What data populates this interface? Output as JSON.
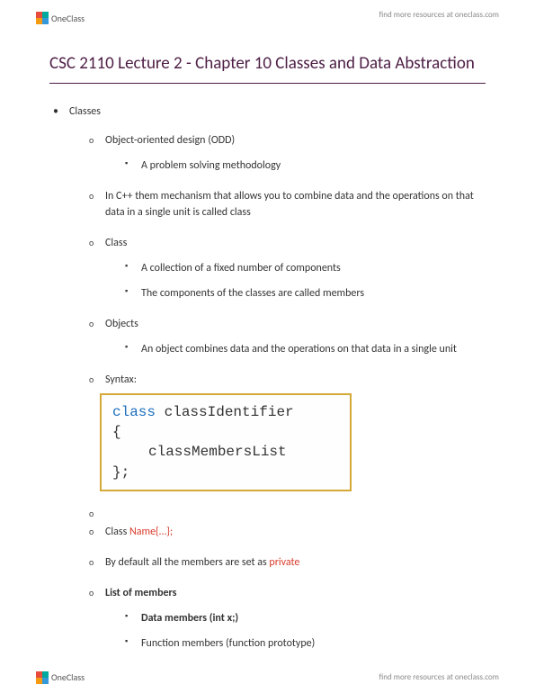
{
  "brand": {
    "name": "OneClass",
    "resources_text": "find more resources at oneclass.com"
  },
  "title": "CSC 2110 Lecture 2 - Chapter 10 Classes and Data Abstraction",
  "outline": {
    "root": "Classes",
    "items": {
      "ood": "Object-oriented design (ODD)",
      "ood_sub": "A problem solving methodology",
      "cpp_mech": "In C++ them mechanism that allows you to combine  data and the operations on that data in a single unit is called class",
      "class": "Class",
      "class_sub1": "A collection of a fixed number of components",
      "class_sub2": "The components of the classes are called members",
      "objects": "Objects",
      "objects_sub": "An object combines data and the operations on that data in a single unit",
      "syntax": "Syntax:",
      "class_name_pre": "Class ",
      "class_name_red": "Name{…};",
      "default_pre": "By default all the members are set as ",
      "default_red": "private",
      "list_members": "List of members",
      "data_members": "Data members (int x;)",
      "func_members": "Function members (function prototype)"
    }
  },
  "codebox": {
    "kw": "class",
    "ident": " classIdentifier",
    "open": "{",
    "body": "classMembersList",
    "close": "};"
  }
}
